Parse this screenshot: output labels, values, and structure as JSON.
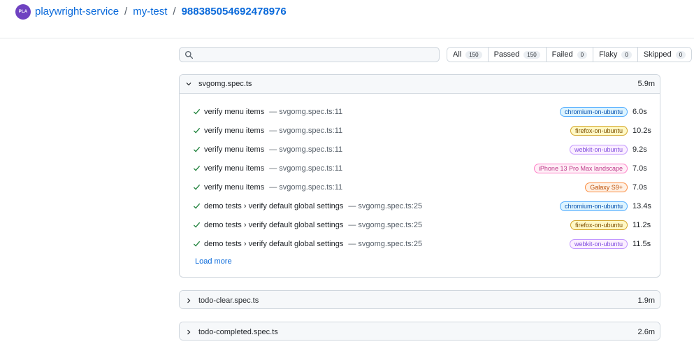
{
  "header": {
    "avatar_initials": "PLA",
    "breadcrumb": [
      "playwright-service",
      "my-test",
      "988385054692478976"
    ],
    "separator": "/"
  },
  "search": {
    "value": "",
    "placeholder": ""
  },
  "filters": [
    {
      "label": "All",
      "count": "150"
    },
    {
      "label": "Passed",
      "count": "150"
    },
    {
      "label": "Failed",
      "count": "0"
    },
    {
      "label": "Flaky",
      "count": "0"
    },
    {
      "label": "Skipped",
      "count": "0"
    }
  ],
  "files": [
    {
      "name": "svgomg.spec.ts",
      "duration": "5.9m",
      "expanded": true,
      "tests": [
        {
          "title": "verify menu items",
          "location": "— svgomg.spec.ts:11",
          "project": "chromium-on-ubuntu",
          "project_color": "blue",
          "duration": "6.0s"
        },
        {
          "title": "verify menu items",
          "location": "— svgomg.spec.ts:11",
          "project": "firefox-on-ubuntu",
          "project_color": "yellow",
          "duration": "10.2s"
        },
        {
          "title": "verify menu items",
          "location": "— svgomg.spec.ts:11",
          "project": "webkit-on-ubuntu",
          "project_color": "purple",
          "duration": "9.2s"
        },
        {
          "title": "verify menu items",
          "location": "— svgomg.spec.ts:11",
          "project": "iPhone 13 Pro Max landscape",
          "project_color": "pink",
          "duration": "7.0s"
        },
        {
          "title": "verify menu items",
          "location": "— svgomg.spec.ts:11",
          "project": "Galaxy S9+",
          "project_color": "red",
          "duration": "7.0s"
        },
        {
          "title": "demo tests › verify default global settings",
          "location": "— svgomg.spec.ts:25",
          "project": "chromium-on-ubuntu",
          "project_color": "blue",
          "duration": "13.4s"
        },
        {
          "title": "demo tests › verify default global settings",
          "location": "— svgomg.spec.ts:25",
          "project": "firefox-on-ubuntu",
          "project_color": "yellow",
          "duration": "11.2s"
        },
        {
          "title": "demo tests › verify default global settings",
          "location": "— svgomg.spec.ts:25",
          "project": "webkit-on-ubuntu",
          "project_color": "purple",
          "duration": "11.5s"
        }
      ],
      "load_more": "Load more"
    },
    {
      "name": "todo-clear.spec.ts",
      "duration": "1.9m",
      "expanded": false
    },
    {
      "name": "todo-completed.spec.ts",
      "duration": "2.6m",
      "expanded": false
    }
  ],
  "colors": {
    "link": "#0969da",
    "check": "#1a7f37",
    "avatar": "#6f42c1",
    "badge_blue": {
      "bg": "#ddf4ff",
      "border": "#54aeff",
      "text": "#0550ae"
    },
    "badge_yellow": {
      "bg": "#fff8c5",
      "border": "#d4a72c",
      "text": "#7d4e00"
    },
    "badge_purple": {
      "bg": "#fbefff",
      "border": "#c297ff",
      "text": "#8250df"
    },
    "badge_pink": {
      "bg": "#ffeff7",
      "border": "#ff80c8",
      "text": "#bf3989"
    },
    "badge_red": {
      "bg": "#fff1e5",
      "border": "#fb8f44",
      "text": "#bc4c00"
    }
  }
}
